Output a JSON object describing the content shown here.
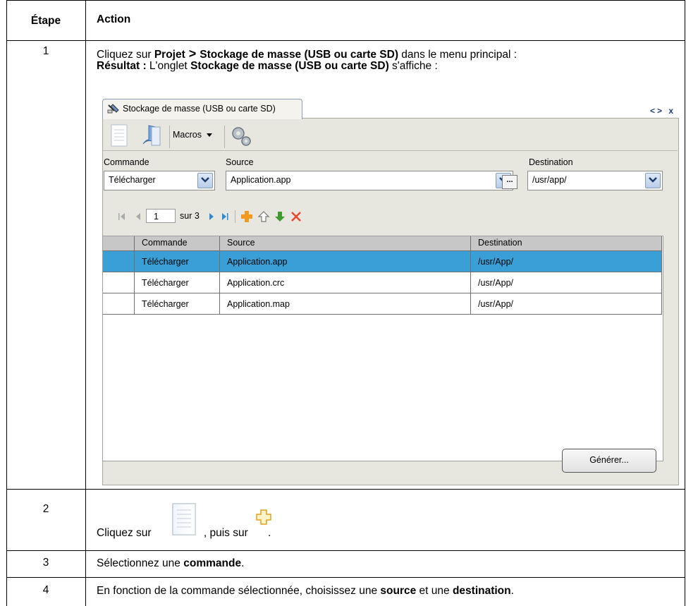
{
  "table": {
    "header": {
      "step": "Étape",
      "action": "Action"
    },
    "rows": [
      {
        "step": "1",
        "line1": {
          "pre": "Cliquez sur ",
          "b1": "Projet",
          "sep": " > ",
          "b2": "Stockage de masse (USB ou carte SD)",
          "post": " dans le menu principal :"
        },
        "line2": {
          "b1": "Résultat :",
          "mid": " L'onglet ",
          "b2": "Stockage de masse (USB ou carte SD)",
          "post": " s'affiche :"
        }
      },
      {
        "step": "2",
        "pre": "Cliquez sur ",
        "mid": ", puis sur ",
        "post": "."
      },
      {
        "step": "3",
        "pre": "Sélectionnez une ",
        "b1": "commande",
        "post": "."
      },
      {
        "step": "4",
        "pre": "En fonction de la commande sélectionnée, choisissez une ",
        "b1": "source",
        "mid": " et une ",
        "b2": "destination",
        "post": "."
      }
    ]
  },
  "screenshot": {
    "tab_title": "Stockage de masse (USB ou carte SD)",
    "window_controls": "<> x",
    "toolbar": {
      "macros_label": "Macros"
    },
    "fields": {
      "command": {
        "label": "Commande",
        "value": "Télécharger"
      },
      "source": {
        "label": "Source",
        "value": "Application.app"
      },
      "destination": {
        "label": "Destination",
        "value": "/usr/app/"
      },
      "browse_label": "..."
    },
    "navigator": {
      "current_page": "1",
      "total": "sur 3"
    },
    "grid": {
      "columns": [
        "Commande",
        "Source",
        "Destination"
      ],
      "rows": [
        {
          "command": "Télécharger",
          "source": "Application.app",
          "destination": "/usr/App/"
        },
        {
          "command": "Télécharger",
          "source": "Application.crc",
          "destination": "/usr/App/"
        },
        {
          "command": "Télécharger",
          "source": "Application.map",
          "destination": "/usr/App/"
        }
      ],
      "selected_row": 0
    },
    "generate_button": "Générer...",
    "colors": {
      "selected_row": "#3a9fd6",
      "panel_bg": "#e7e6df",
      "add_icon": "#f29a1f",
      "delete_icon": "#e8472c",
      "down_icon": "#3c9a2e"
    }
  }
}
